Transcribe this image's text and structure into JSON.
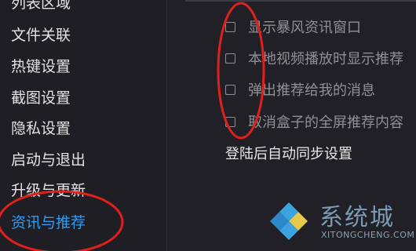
{
  "sidebar": {
    "items": [
      {
        "label": "列表区域",
        "active": false
      },
      {
        "label": "文件关联",
        "active": false
      },
      {
        "label": "热键设置",
        "active": false
      },
      {
        "label": "截图设置",
        "active": false
      },
      {
        "label": "隐私设置",
        "active": false
      },
      {
        "label": "启动与退出",
        "active": false
      },
      {
        "label": "升级与更新",
        "active": false
      },
      {
        "label": "资讯与推荐",
        "active": true
      }
    ]
  },
  "options": [
    {
      "label": "显示暴风资讯窗口",
      "checked": false
    },
    {
      "label": "本地视频播放时显示推荐",
      "checked": false
    },
    {
      "label": "弹出推荐给我的消息",
      "checked": false
    },
    {
      "label": "取消盒子的全屏推荐内容",
      "checked": false
    }
  ],
  "section": {
    "sync_title": "登陆后自动同步设置"
  },
  "watermark": {
    "brand_text": "系统城",
    "url": "XITONGCHENG.COM"
  },
  "colors": {
    "background": "#1f1f25",
    "accent": "#2e9cf0",
    "annotation": "#e0201c"
  }
}
